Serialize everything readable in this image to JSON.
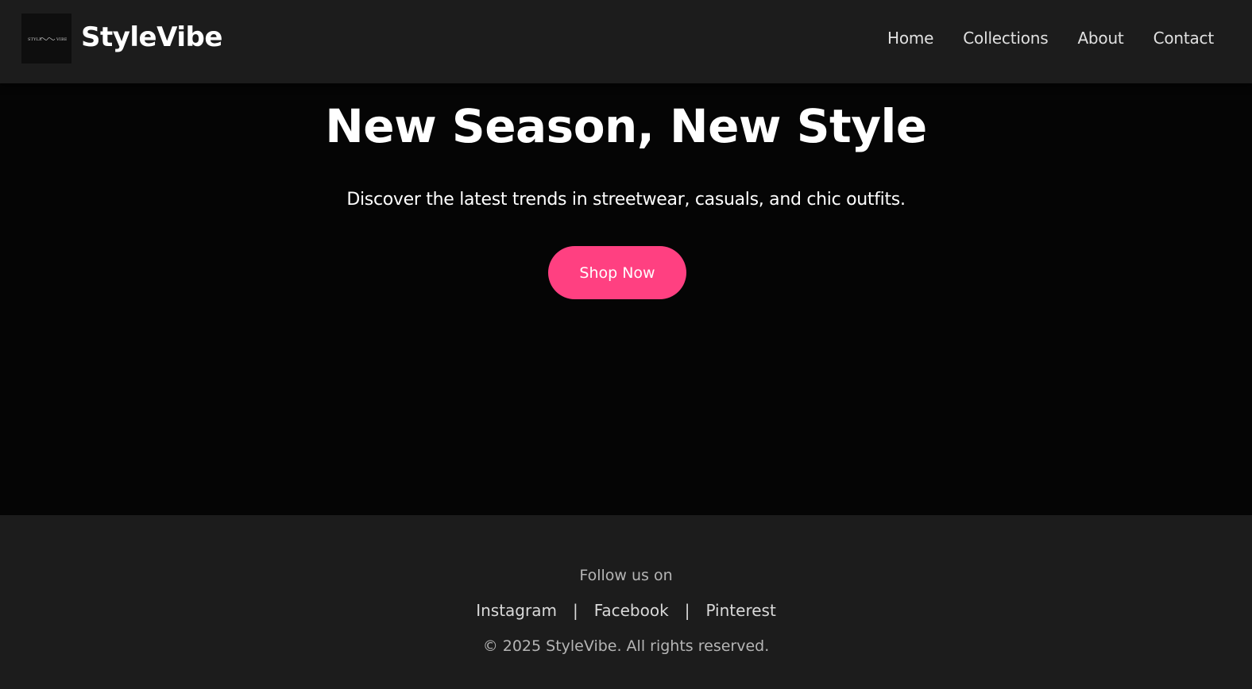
{
  "header": {
    "logo_text": "STYLE VIBE",
    "brand": "StyleVibe",
    "nav": [
      {
        "label": "Home"
      },
      {
        "label": "Collections"
      },
      {
        "label": "About"
      },
      {
        "label": "Contact"
      }
    ]
  },
  "hero": {
    "title": "New Season, New Style",
    "subtitle": "Discover the latest trends in streetwear, casuals, and chic outfits.",
    "cta_label": "Shop Now"
  },
  "footer": {
    "follow_text": "Follow us on",
    "social": [
      {
        "label": "Instagram"
      },
      {
        "label": "Facebook"
      },
      {
        "label": "Pinterest"
      }
    ],
    "separator": "|",
    "copyright": "© 2025 StyleVibe. All rights reserved."
  },
  "colors": {
    "header_bg": "#1c1c1c",
    "hero_bg": "#050505",
    "accent": "#ff4081",
    "text": "#ffffff",
    "muted_text": "#b5b5b5"
  }
}
